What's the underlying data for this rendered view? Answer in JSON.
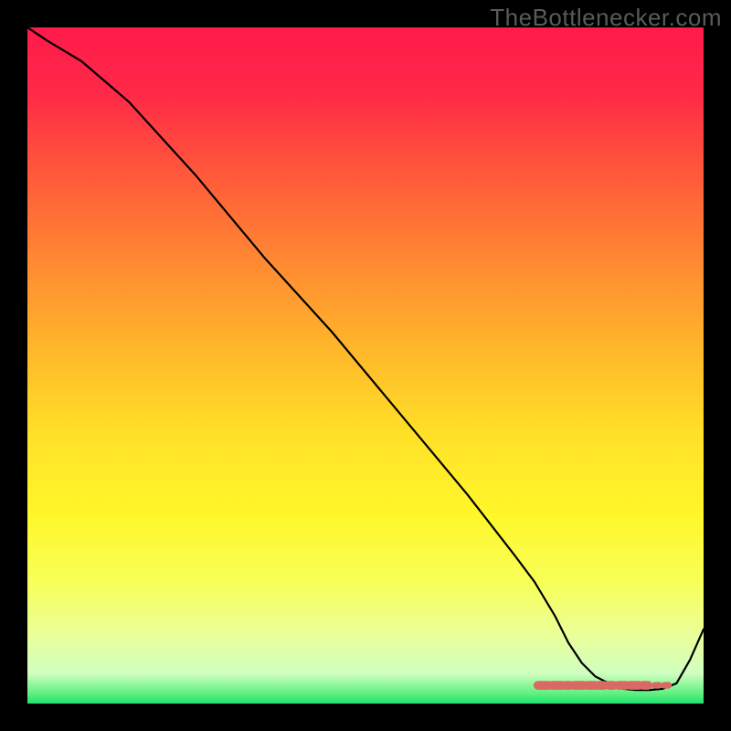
{
  "watermark": "TheBottlenecker.com",
  "gradient": {
    "stops": [
      {
        "offset": 0.0,
        "color": "#ff1a4a"
      },
      {
        "offset": 0.1,
        "color": "#ff2a48"
      },
      {
        "offset": 0.22,
        "color": "#ff5a3a"
      },
      {
        "offset": 0.35,
        "color": "#ff8a32"
      },
      {
        "offset": 0.48,
        "color": "#ffb82a"
      },
      {
        "offset": 0.6,
        "color": "#ffe028"
      },
      {
        "offset": 0.72,
        "color": "#fff72a"
      },
      {
        "offset": 0.82,
        "color": "#f8ff58"
      },
      {
        "offset": 0.9,
        "color": "#eaff9a"
      },
      {
        "offset": 0.955,
        "color": "#d0ffc0"
      },
      {
        "offset": 0.985,
        "color": "#60f080"
      },
      {
        "offset": 1.0,
        "color": "#20e070"
      }
    ]
  },
  "chart_data": {
    "type": "line",
    "title": "",
    "xlabel": "",
    "ylabel": "",
    "xlim": [
      0,
      100
    ],
    "ylim": [
      0,
      100
    ],
    "series": [
      {
        "name": "curve",
        "stroke": "#000000",
        "stroke_width": 2.2,
        "x": [
          0,
          3,
          8,
          15,
          25,
          35,
          45,
          55,
          65,
          72,
          75,
          78,
          80,
          82,
          84,
          86,
          88,
          90,
          92,
          94,
          96,
          98,
          100
        ],
        "y": [
          100,
          98,
          95,
          89,
          78,
          66,
          55,
          43,
          31,
          22,
          18,
          13,
          9,
          6,
          4,
          3,
          2.2,
          2.0,
          2.0,
          2.2,
          3.0,
          6.5,
          11
        ]
      }
    ],
    "markers": {
      "name": "threshold-dashes",
      "color": "#d96a63",
      "y_level": 2.7,
      "segments": [
        {
          "x0": 75.5,
          "x1": 77.0,
          "thick": 4
        },
        {
          "x0": 77.5,
          "x1": 79.0,
          "thick": 4
        },
        {
          "x0": 79.5,
          "x1": 80.2,
          "thick": 4
        },
        {
          "x0": 80.8,
          "x1": 82.3,
          "thick": 4
        },
        {
          "x0": 82.9,
          "x1": 84.0,
          "thick": 4
        },
        {
          "x0": 84.5,
          "x1": 85.3,
          "thick": 4
        },
        {
          "x0": 86.0,
          "x1": 86.7,
          "thick": 4
        },
        {
          "x0": 87.4,
          "x1": 88.6,
          "thick": 4
        },
        {
          "x0": 89.2,
          "x1": 90.4,
          "thick": 4
        },
        {
          "x0": 91.0,
          "x1": 91.8,
          "thick": 4
        },
        {
          "x0": 92.8,
          "x1": 93.4,
          "thick": 3
        },
        {
          "x0": 94.2,
          "x1": 94.8,
          "thick": 3
        }
      ]
    }
  }
}
